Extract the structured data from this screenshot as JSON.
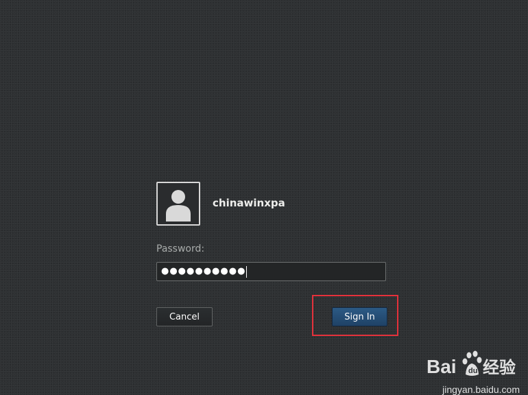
{
  "login": {
    "username": "chinawinxpa",
    "password_label": "Password:",
    "password_masked": "●●●●●●●●●●",
    "cancel_label": "Cancel",
    "signin_label": "Sign In"
  },
  "watermark": {
    "logo_text": "Bai du 经验",
    "url": "jingyan.baidu.com"
  },
  "colors": {
    "background": "#2e3133",
    "signin_button": "#2c5a85",
    "highlight": "#e5313b"
  },
  "icons": {
    "avatar": "user-avatar-icon",
    "watermark": "baidu-paw-icon"
  }
}
